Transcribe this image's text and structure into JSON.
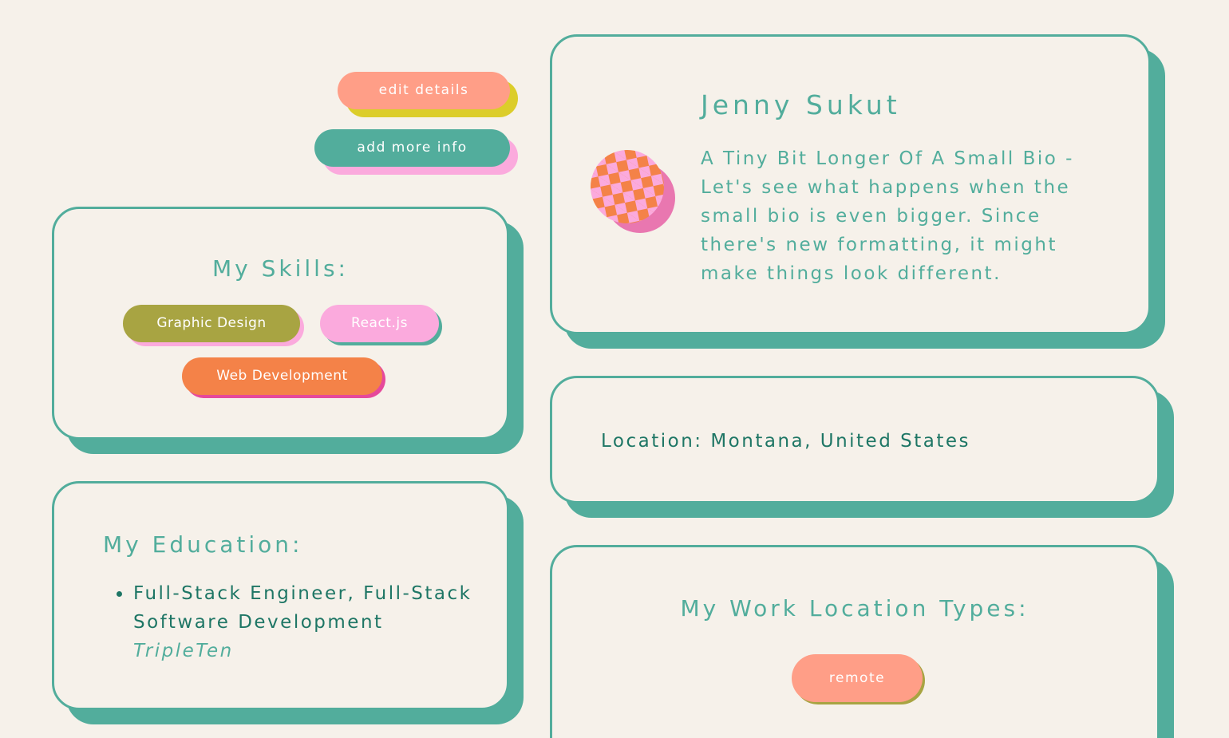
{
  "actions": {
    "edit_label": "edit details",
    "add_label": "add more info"
  },
  "skills": {
    "title": "My Skills:",
    "items": [
      {
        "label": "Graphic Design"
      },
      {
        "label": "React.js"
      },
      {
        "label": "Web Development"
      }
    ]
  },
  "education": {
    "title": "My Education:",
    "items": [
      {
        "degree": "Full-Stack Engineer, Full-Stack Software Development",
        "school": "TripleTen"
      }
    ]
  },
  "profile": {
    "name": "Jenny Sukut",
    "bio": "A Tiny Bit Longer Of A Small Bio - Let's see what happens when the small bio is even bigger. Since there's new formatting, it might make things look different."
  },
  "location": {
    "text": "Location: Montana, United States"
  },
  "work_location_types": {
    "title": "My Work Location Types:",
    "items": [
      {
        "label": "remote"
      }
    ]
  },
  "colors": {
    "background": "#f6f1ea",
    "teal": "#52ad9c",
    "dark_teal": "#1e7665",
    "salmon": "#ff9e87",
    "pink": "#fbaadd",
    "olive": "#a8a442",
    "orange": "#f48248",
    "yellow": "#dccd2a"
  }
}
